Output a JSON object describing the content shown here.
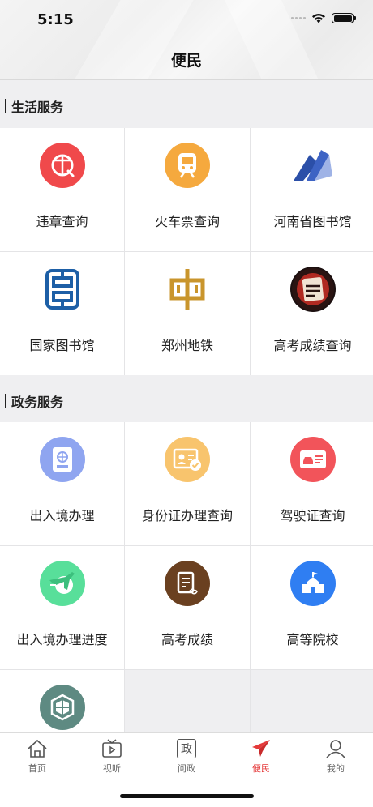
{
  "status_bar": {
    "time": "5:15"
  },
  "header": {
    "title": "便民"
  },
  "sections": [
    {
      "title": "生活服务",
      "items": [
        {
          "label": "违章查询",
          "icon": "violation-icon",
          "color": "#f0494b"
        },
        {
          "label": "火车票查询",
          "icon": "train-icon",
          "color": "#f5a93e"
        },
        {
          "label": "河南省图书馆",
          "icon": "henan-library-logo-icon",
          "color": "#2b4fa8"
        },
        {
          "label": "国家图书馆",
          "icon": "national-library-logo-icon",
          "color": "#1d5fa6"
        },
        {
          "label": "郑州地铁",
          "icon": "zhengzhou-metro-logo-icon",
          "color": "#c9952c"
        },
        {
          "label": "高考成绩查询",
          "icon": "gaokao-badge-icon",
          "color": "#7b1b16"
        }
      ]
    },
    {
      "title": "政务服务",
      "items": [
        {
          "label": "出入境办理",
          "icon": "passport-icon",
          "color": "#8fa5f0"
        },
        {
          "label": "身份证办理查询",
          "icon": "id-card-icon",
          "color": "#f8c46d"
        },
        {
          "label": "驾驶证查询",
          "icon": "driver-license-icon",
          "color": "#f2545a"
        },
        {
          "label": "出入境办理进度",
          "icon": "plane-progress-icon",
          "color": "#58df9a"
        },
        {
          "label": "高考成绩",
          "icon": "score-sheet-icon",
          "color": "#6a4020"
        },
        {
          "label": "高等院校",
          "icon": "school-icon",
          "color": "#2f7ef2"
        },
        {
          "label": "",
          "icon": "shield-icon",
          "color": "#5e8a82"
        }
      ]
    }
  ],
  "tabbar": {
    "items": [
      {
        "label": "首页",
        "icon": "home-icon",
        "active": false
      },
      {
        "label": "视听",
        "icon": "tv-icon",
        "active": false
      },
      {
        "label": "问政",
        "icon": "wenzheng-icon",
        "glyph": "政",
        "active": false
      },
      {
        "label": "便民",
        "icon": "paper-plane-icon",
        "active": true
      },
      {
        "label": "我的",
        "icon": "user-icon",
        "active": false
      }
    ],
    "active_color": "#e5393a"
  }
}
